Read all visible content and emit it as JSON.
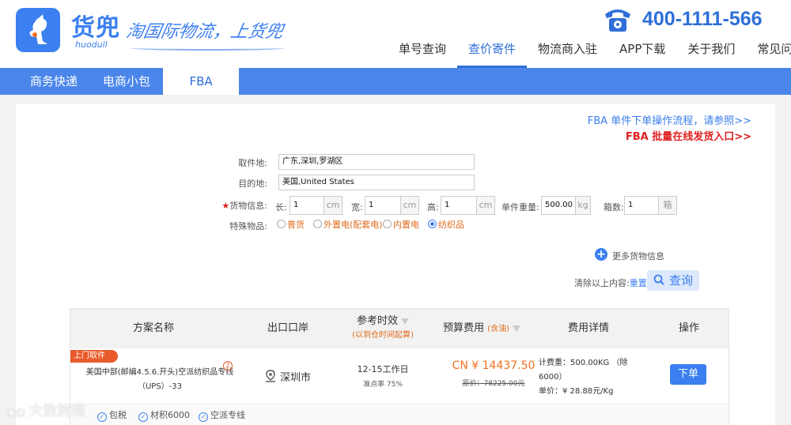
{
  "header": {
    "brand_cn": "货兜",
    "brand_en": "huodull",
    "slogan": "淘国际物流，上货兜",
    "phone": "400-1111-566",
    "nav": [
      {
        "label": "单号查询",
        "active": false
      },
      {
        "label": "查价寄件",
        "active": true
      },
      {
        "label": "物流商入驻",
        "active": false
      },
      {
        "label": "APP下载",
        "active": false
      },
      {
        "label": "关于我们",
        "active": false
      },
      {
        "label": "常见问题",
        "active": false
      }
    ]
  },
  "subnav": {
    "tabs": [
      {
        "label": "商务快递",
        "active": false
      },
      {
        "label": "电商小包",
        "active": false
      },
      {
        "label": "FBA",
        "active": true
      }
    ]
  },
  "links": {
    "fba_flow": "FBA 单件下单操作流程，请参照>>",
    "fba_batch": "FBA 批量在线发货入口>>"
  },
  "form": {
    "origin_label": "取件地:",
    "origin_value": "广东,深圳,罗湖区",
    "dest_label": "目的地:",
    "dest_value": "美国,United States",
    "cargo_label": "货物信息:",
    "length_label": "长:",
    "length_value": "1",
    "width_label": "宽:",
    "width_value": "1",
    "height_label": "高:",
    "height_value": "1",
    "unit_cm": "cm",
    "weight_label": "单件重量:",
    "weight_value": "500.00",
    "unit_kg": "kg",
    "boxes_label": "箱数:",
    "boxes_value": "1",
    "unit_box": "箱",
    "special_label": "特殊物品:",
    "special_options": [
      {
        "label": "普货",
        "checked": false
      },
      {
        "label": "外置电(配套电)",
        "checked": false
      },
      {
        "label": "内置电",
        "checked": false
      },
      {
        "label": "纺织品",
        "checked": true
      }
    ],
    "more_cargo": "更多货物信息",
    "clear_text": "清除以上内容:",
    "reset": "重置",
    "query": "查询"
  },
  "table": {
    "headers": {
      "plan": "方案名称",
      "port": "出口口岸",
      "eta": "参考时效",
      "eta_sub": "(以到仓时间起算)",
      "cost": "预算费用",
      "cost_sub": "(含油)",
      "detail": "费用详情",
      "action": "操作"
    },
    "rows": [
      {
        "tag": "上门取件",
        "name": "美国中部(邮编4.5.6.开头)空派纺织品专线（UPS）-33",
        "badge": "②",
        "port": "深圳市",
        "eta": "12-15工作日",
        "ontime": "准点率 75%",
        "price": "CN ¥ 14437.50",
        "orig_price": "原价：78225.00元",
        "detail_line1": "计费重：500.00KG （除",
        "detail_line2": "6000）",
        "detail_line3": "单价：¥ 28.88元/Kg",
        "order": "下单",
        "features": [
          "包税",
          "材积6000",
          "空派专线"
        ]
      }
    ]
  },
  "watermark": "大数跨境",
  "colors": {
    "primary": "#3b7ff0",
    "bar": "#4a86ea",
    "orange": "#f2701e",
    "red": "#e02020"
  }
}
